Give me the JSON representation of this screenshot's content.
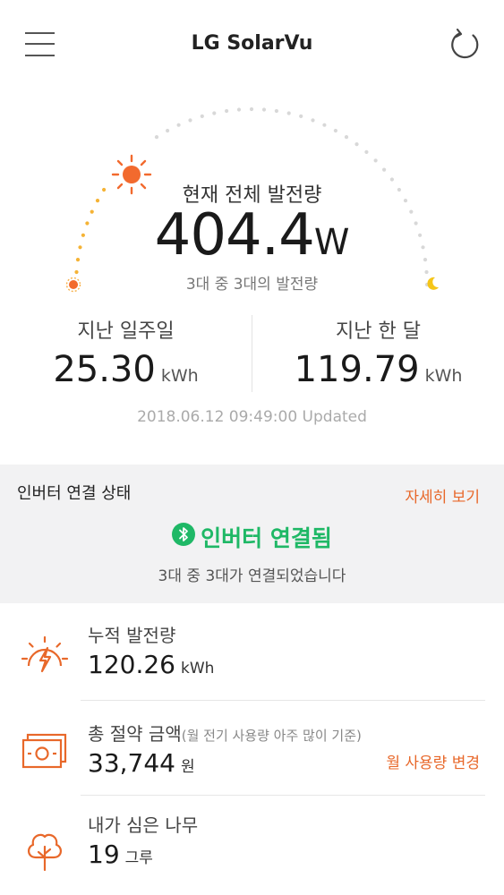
{
  "header": {
    "title": "LG SolarVu",
    "menu_icon": "hamburger-menu-icon",
    "refresh_icon": "refresh-icon"
  },
  "current": {
    "label": "현재 전체 발전량",
    "value": "404.4",
    "unit": "W",
    "sub": "3대 중 3대의 발전량"
  },
  "stats": {
    "week": {
      "label": "지난 일주일",
      "value": "25.30",
      "unit": "kWh"
    },
    "month": {
      "label": "지난 한 달",
      "value": "119.79",
      "unit": "kWh"
    }
  },
  "updated": "2018.06.12 09:49:00 Updated",
  "inverter": {
    "title": "인버터 연결 상태",
    "detail_link": "자세히 보기",
    "status": "인버터 연결됨",
    "sub": "3대 중 3대가 연결되었습니다"
  },
  "summary": {
    "cumulative": {
      "label": "누적 발전량",
      "value": "120.26",
      "unit": "kWh",
      "icon": "sun-bolt-icon"
    },
    "savings": {
      "label": "총 절약 금액",
      "note": "(월 전기 사용량 아주 많이 기준)",
      "value": "33,744",
      "unit": "원",
      "action": "월 사용량 변경",
      "icon": "money-icon"
    },
    "trees": {
      "label": "내가 심은 나무",
      "value": "19",
      "unit": "그루",
      "icon": "tree-icon"
    }
  },
  "colors": {
    "accent_orange": "#e8682a",
    "status_green": "#1fb866",
    "section_bg": "#f2f2f3"
  }
}
